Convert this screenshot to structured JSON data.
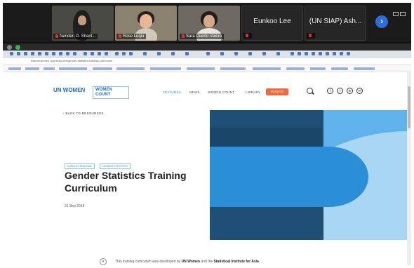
{
  "participants": [
    {
      "name": "Nenden O. Shant..."
    },
    {
      "name": "Rose Luqiu"
    },
    {
      "name": "Sara Duerto Valero"
    },
    {
      "name": "Eunkoo Lee"
    },
    {
      "name": "(UN SIAP) Ash..."
    }
  ],
  "controls": {
    "next_icon": "chevron-right-icon",
    "next_glyph": "›"
  },
  "browser": {
    "url": "data.unwomen.org/resources/gender-statistics-training-curriculum"
  },
  "site": {
    "logo_primary": "UN WOMEN",
    "logo_secondary_line1": "WOMEN",
    "logo_secondary_line2": "COUNT",
    "nav": [
      "FEATURES",
      "NEWS",
      "WOMEN COUNT",
      "LIBRARY"
    ],
    "donate": "DONATE",
    "social": [
      "f",
      "t",
      "in",
      "✉"
    ]
  },
  "article": {
    "back_label": "‹ BACK TO RESOURCES",
    "tags": [
      "CAPACITY BUILDING",
      "GENDER STATISTICS"
    ],
    "title": "Gender Statistics Training Curriculum",
    "date": "21 Sep 2018",
    "footer_prefix": "This training curriculum was developed by ",
    "footer_org1": "UN Women",
    "footer_mid": " and the ",
    "footer_org2": "Statistical Institute for Asia"
  },
  "colors": {
    "hero_dark": "#1f4f75",
    "hero_mid": "#2a8fd6",
    "hero_light": "#a9d6f5",
    "zoom_blue": "#2d6fd8"
  }
}
